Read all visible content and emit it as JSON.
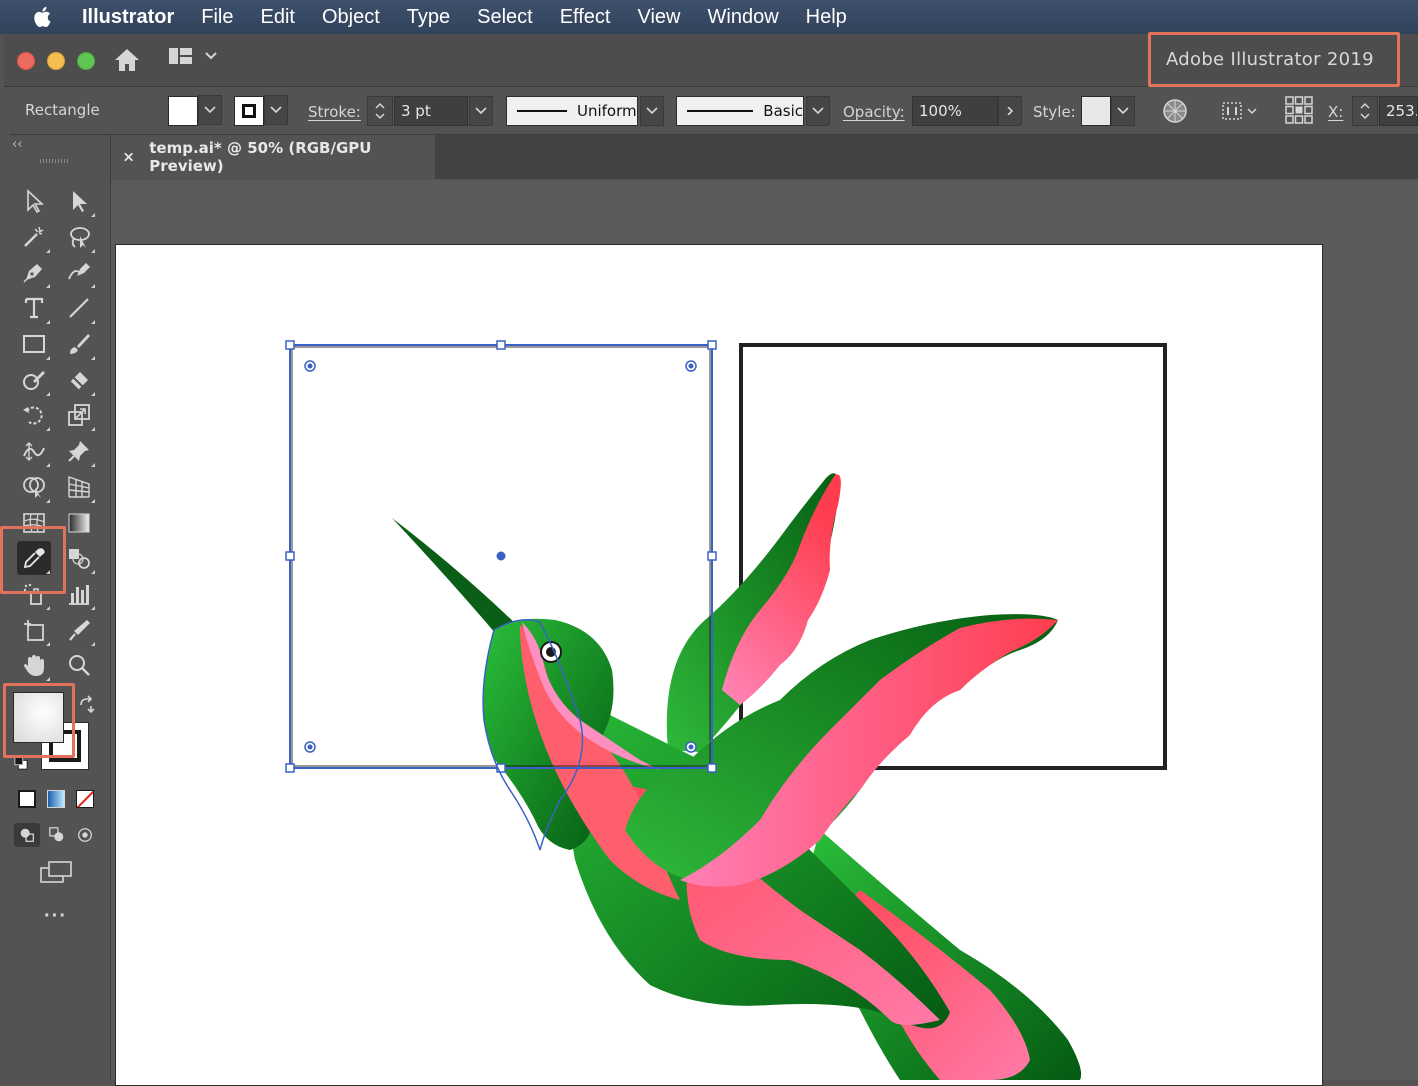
{
  "menubar": {
    "app_name": "Illustrator",
    "items": [
      "File",
      "Edit",
      "Object",
      "Type",
      "Select",
      "Effect",
      "View",
      "Window",
      "Help"
    ]
  },
  "titlebar": {
    "app_version": "Adobe Illustrator 2019"
  },
  "controlbar": {
    "selection_type": "Rectangle",
    "stroke_label": "Stroke:",
    "stroke_weight": "3 pt",
    "variable_width_profile": "Uniform",
    "brush_definition": "Basic",
    "opacity_label": "Opacity:",
    "opacity_value": "100%",
    "style_label": "Style:",
    "x_label": "X:",
    "x_value": "253."
  },
  "document": {
    "tab_title": "temp.ai* @ 50% (RGB/GPU Preview)"
  },
  "colors": {
    "highlight": "#e2725b",
    "selection": "#3a62c4",
    "accent_green": "#1a8f2e",
    "accent_pink": "#ff5a78"
  },
  "tools": [
    "selection-tool",
    "direct-selection-tool",
    "magic-wand-tool",
    "lasso-tool",
    "pen-tool",
    "curvature-tool",
    "type-tool",
    "line-segment-tool",
    "rectangle-tool",
    "paintbrush-tool",
    "shaper-tool",
    "eraser-tool",
    "rotate-tool",
    "scale-tool",
    "width-tool",
    "puppet-warp-tool",
    "shape-builder-tool",
    "perspective-grid-tool",
    "mesh-tool",
    "gradient-tool",
    "eyedropper-tool",
    "blend-tool",
    "symbol-sprayer-tool",
    "column-graph-tool",
    "artboard-tool",
    "slice-tool",
    "hand-tool",
    "zoom-tool"
  ]
}
